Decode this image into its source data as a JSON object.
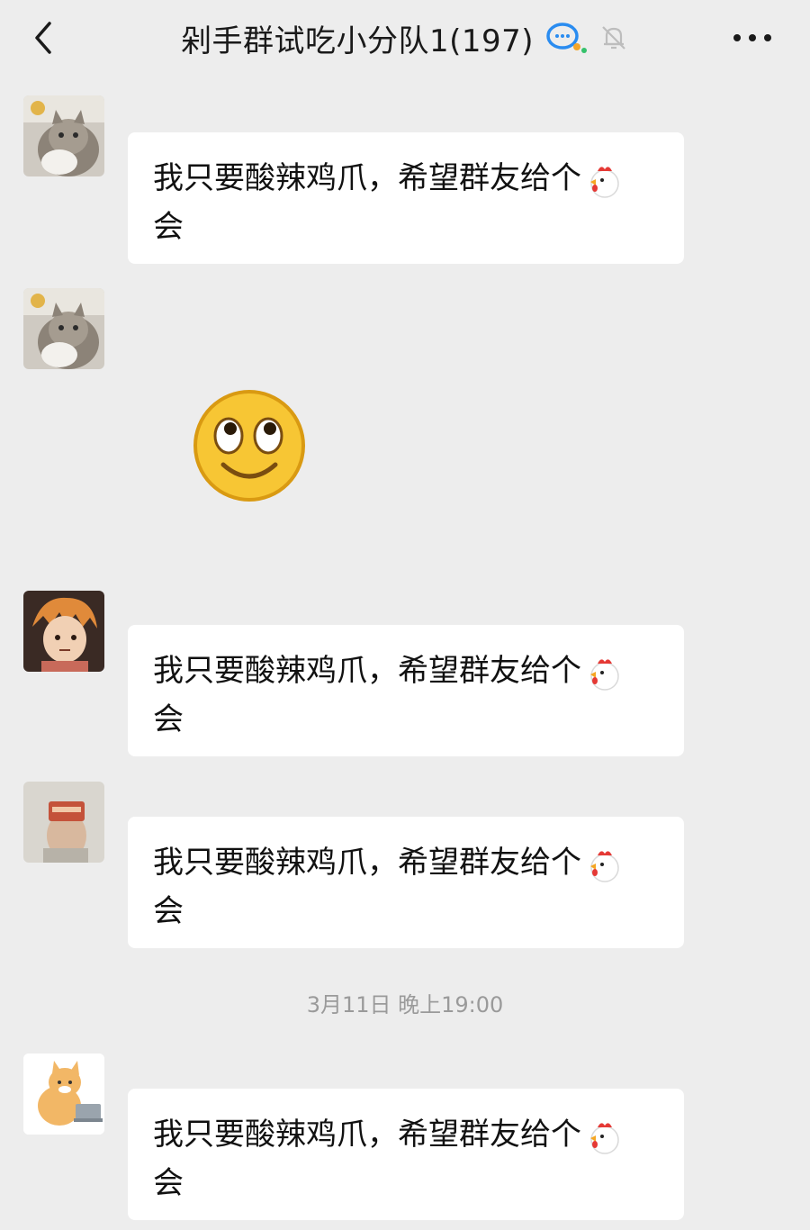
{
  "header": {
    "title": "剁手群试吃小分队1(197)",
    "back_icon": "chevron-left-icon",
    "chat_icon": "group-chat-icon",
    "mute_icon": "bell-mute-icon",
    "more_icon": "more-dots-icon"
  },
  "messages": [
    {
      "nickname": "",
      "text": "我只要酸辣鸡爪，希望群友给个",
      "text_tail": "会",
      "emoji": "chicken-emoji"
    },
    {
      "nickname": "",
      "sticker": "smiley-face-sticker"
    },
    {
      "nickname": "",
      "text": "我只要酸辣鸡爪，希望群友给个",
      "text_tail": "会",
      "emoji": "chicken-emoji"
    },
    {
      "nickname": "",
      "text": "我只要酸辣鸡爪，希望群友给个",
      "text_tail": "会",
      "emoji": "chicken-emoji"
    },
    {
      "nickname": "",
      "text": "我只要酸辣鸡爪，希望群友给个",
      "text_tail": "会",
      "emoji": "chicken-emoji"
    }
  ],
  "timestamp": "3月11日 晚上19:00",
  "colors": {
    "background": "#ededed",
    "bubble": "#ffffff",
    "time_text": "#9a9a9a"
  }
}
